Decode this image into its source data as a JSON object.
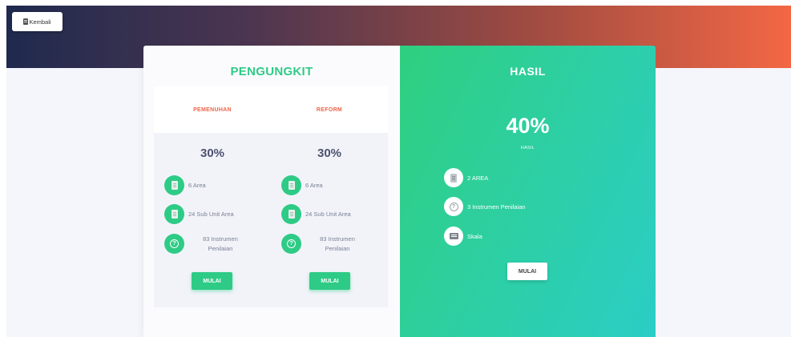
{
  "header": {
    "back_label": "Kembali"
  },
  "pengungkit": {
    "title": "PENGUNGKIT",
    "cards": [
      {
        "title": "PEMENUHAN",
        "percent": "30%",
        "area": "6 Area",
        "sub_unit": "24 Sub Unit Area",
        "instrumen_line1": "83 Instrumen",
        "instrumen_line2": "Penilaian",
        "button": "MULAI"
      },
      {
        "title": "REFORM",
        "percent": "30%",
        "area": "6 Area",
        "sub_unit": "24 Sub Unit Area",
        "instrumen_line1": "83 Instrumen",
        "instrumen_line2": "Penilaian",
        "button": "MULAI"
      }
    ]
  },
  "hasil": {
    "title": "HASIL",
    "percent": "40%",
    "percent_label": "HASIL",
    "items": [
      "2 AREA",
      "3 Instrumen Penilaian",
      "Skala"
    ],
    "button": "MULAI"
  },
  "colors": {
    "accent_green": "#2ecb86",
    "accent_red": "#f0644a",
    "header_gradient_start": "#1f2a4e",
    "header_gradient_end": "#f36744"
  },
  "icons": {
    "area": "document-icon",
    "sub_unit": "document-icon",
    "instrumen": "question-circle-icon",
    "skala": "scale-icon",
    "back": "document-icon"
  }
}
